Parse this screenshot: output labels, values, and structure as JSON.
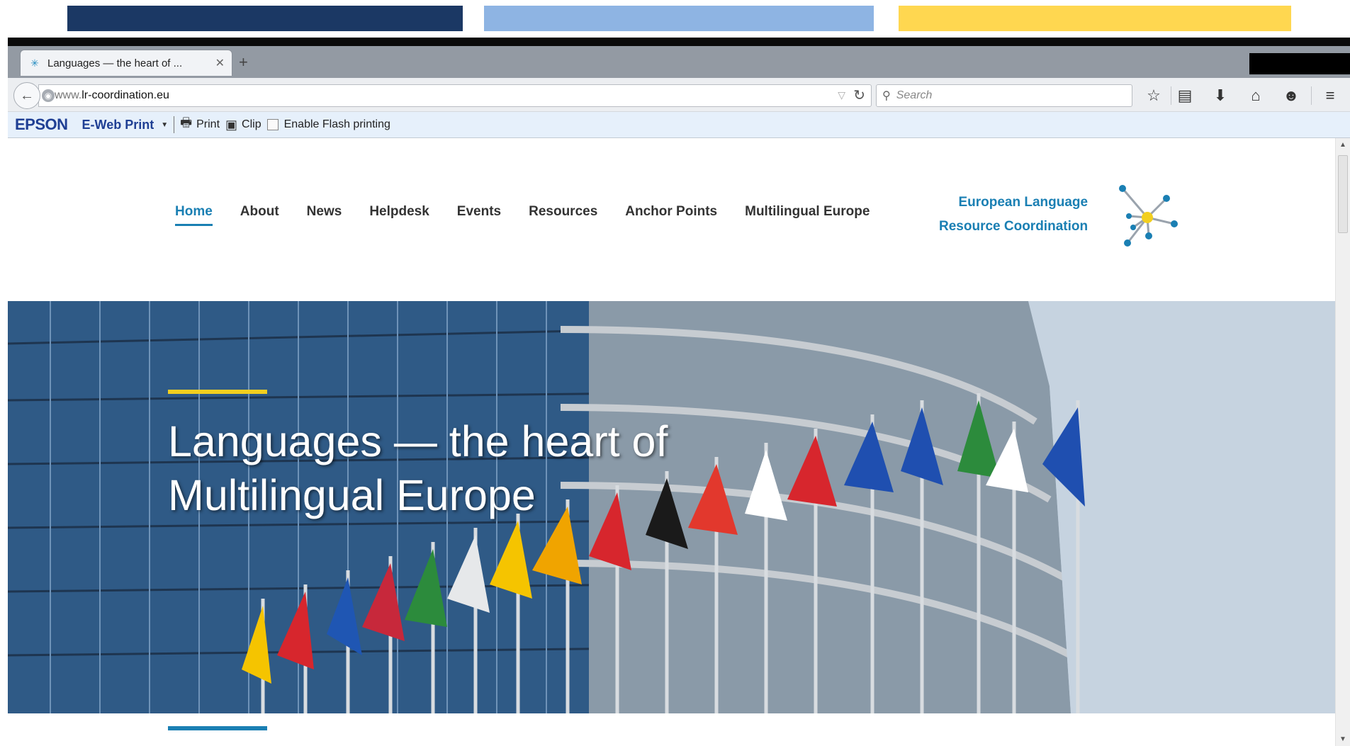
{
  "decor": {
    "bar_colors": [
      "#1b3864",
      "#8eb4e3",
      "#ffd750"
    ]
  },
  "browser": {
    "tab": {
      "title": "Languages — the heart of ...",
      "close_icon": "close-icon",
      "new_tab_icon": "plus-icon"
    },
    "url": {
      "prefix": "www.",
      "domain": "lr-coordination.eu"
    },
    "search": {
      "placeholder": "Search"
    },
    "toolbar_icons": [
      "star-icon",
      "reading-list-icon",
      "download-icon",
      "home-icon",
      "chat-icon",
      "menu-icon"
    ]
  },
  "epson": {
    "logo": "EPSON",
    "product": "E-Web Print",
    "print_label": "Print",
    "clip_label": "Clip",
    "flash_label": "Enable Flash printing"
  },
  "site": {
    "menu": [
      "Home",
      "About",
      "News",
      "Helpdesk",
      "Events",
      "Resources",
      "Anchor Points",
      "Multilingual Europe"
    ],
    "active_menu": "Home",
    "brand_line1": "European Language",
    "brand_line2": "Resource Coordination",
    "hero_line1": "Languages — the heart of",
    "hero_line2": "Multilingual Europe",
    "accent_color": "#1a7fb3",
    "hero_accent_color": "#f2cf1f"
  }
}
